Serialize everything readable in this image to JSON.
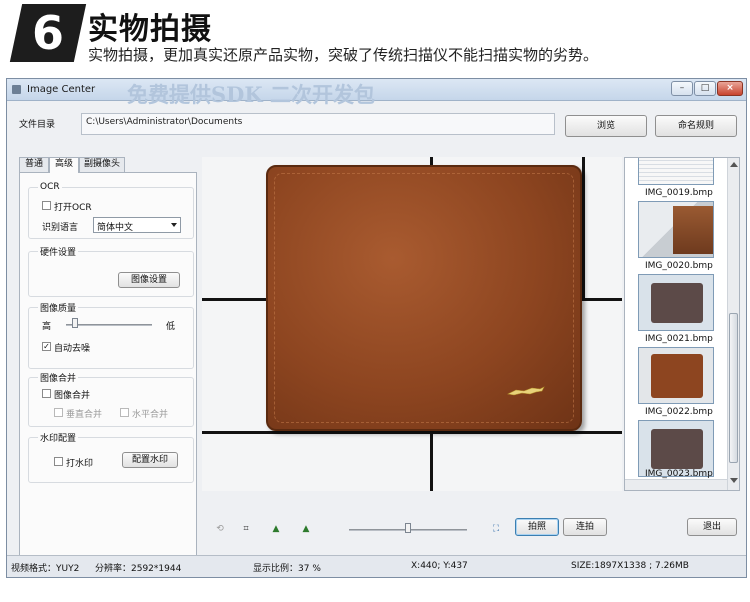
{
  "hero": {
    "number": "6",
    "title": "实物拍摄",
    "subtitle": "实物拍摄，更加真实还原产品实物，突破了传统扫描仪不能扫描实物的劣势。"
  },
  "window": {
    "title": "Image Center",
    "banner_ghost": "免费提供SDK 二次开发包",
    "controls": [
      "–",
      "□",
      "×"
    ]
  },
  "top": {
    "dir_label": "文件目录",
    "path": "C:\\Users\\Administrator\\Documents",
    "browse": "浏览",
    "naming_rule": "命名规则"
  },
  "tabs": [
    "普通",
    "高级",
    "副摄像头"
  ],
  "active_tab": "高级",
  "ocr": {
    "title": "OCR",
    "enable_label": "打开OCR",
    "enable_checked": false,
    "lang_label": "识别语言",
    "lang_value": "简体中文"
  },
  "hardware": {
    "title": "硬件设置",
    "image_settings": "图像设置"
  },
  "quality": {
    "title": "图像质量",
    "high": "高",
    "low": "低",
    "level": 0.1,
    "denoise_label": "自动去噪",
    "denoise_checked": true
  },
  "merge": {
    "title": "图像合并",
    "merge_label": "图像合并",
    "merge_checked": false,
    "vertical": "垂直合并",
    "horizontal": "水平合并"
  },
  "watermark": {
    "title": "水印配置",
    "enable_label": "打水印",
    "enable_checked": false,
    "config": "配置水印"
  },
  "thumbnails": [
    {
      "caption": "IMG_0019.bmp",
      "kind": "document"
    },
    {
      "caption": "IMG_0020.bmp",
      "kind": "photo"
    },
    {
      "caption": "IMG_0021.bmp",
      "kind": "wallet-dark"
    },
    {
      "caption": "IMG_0022.bmp",
      "kind": "wallet-brown"
    },
    {
      "caption": "IMG_0023.bmp",
      "kind": "wallet-dark"
    }
  ],
  "toolbar": {
    "capture": "拍照",
    "continuous": "连拍",
    "exit": "退出",
    "zoom_level": 0.5
  },
  "status": {
    "video_format": "视频格式：YUY2",
    "resolution": "分辨率：2592*1944",
    "display_ratio": "显示比例：37 %",
    "cursor": "X:440; Y:437",
    "size": "SIZE:1897X1338 ; 7.26MB"
  },
  "colors": {
    "wallet": "#8d4520",
    "window_border": "#7d8ea3",
    "titlebar": "#c5d6ea"
  }
}
